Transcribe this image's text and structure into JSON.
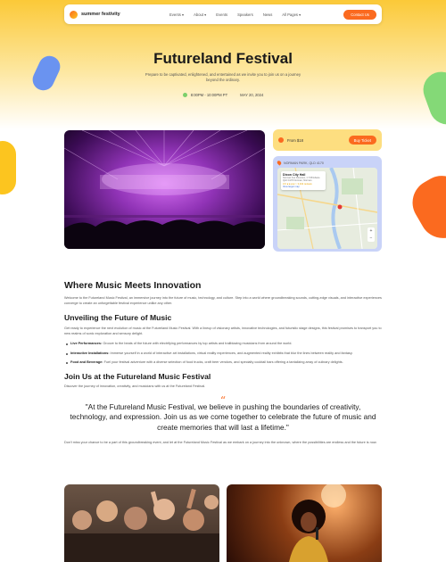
{
  "colors": {
    "accent": "#fb6a1f",
    "yellow": "#fcc51f",
    "price_card": "#fdde80",
    "map_card": "#c9d3f8",
    "text": "#1a1a1a"
  },
  "nav": {
    "brand": "summer festivity",
    "links": [
      "Events ▾",
      "About ▾",
      "Events",
      "Speakers",
      "News",
      "All Pages ▾"
    ],
    "cta": "Contact Us"
  },
  "hero": {
    "title": "Futureland Festival",
    "subtitle": "Prepare to be captivated, enlightened, and entertained as we invite you to join us on a journey beyond the ordinary.",
    "time": "8:00PM - 10:00PM PT",
    "date": "MAY 20, 2024"
  },
  "price": {
    "label": "From $18",
    "button": "Buy Ticket"
  },
  "map": {
    "address": "NORMAN PARK, QLD 4170",
    "place_name": "Dixon City Hall",
    "place_lines": [
      "Norman Ave Dixonton, C 5 Brisbane",
      "QLD 4170 Norman, Norman"
    ],
    "rating": "3.9 ★★★★☆ 3,432 reviews",
    "link": "View larger map"
  },
  "content": {
    "h_main": "Where Music Meets Innovation",
    "p_main": "Welcome to the Futureland Music Festival, an immersive journey into the future of music, technology, and culture. Step into a world where groundbreaking sounds, cutting-edge visuals, and interactive experiences converge to create an unforgettable festival experience unlike any other.",
    "h_unveil": "Unveiling the Future of Music",
    "p_unveil": "Get ready to experience the next evolution of music at the Futureland Music Festival. With a lineup of visionary artists, innovative technologies, and futuristic stage designs, this festival promises to transport you to new realms of sonic exploration and sensory delight.",
    "bullets": [
      {
        "bold": "Live Performances:",
        "text": "Groove to the beats of the future with electrifying performances by top artists and trailblazing musicians from around the world."
      },
      {
        "bold": "Interactive Installations:",
        "text": "Immerse yourself in a world of interactive art installations, virtual reality experiences, and augmented reality exhibits that blur the lines between reality and fantasy."
      },
      {
        "bold": "Food and Beverage:",
        "text": "Fuel your festival adventure with a diverse selection of food trucks, craft beer vendors, and specialty cocktail bars offering a tantalizing array of culinary delights."
      }
    ],
    "h_join": "Join Us at the Futureland Music Festival",
    "p_join": "Discover the journey of innovation, creativity, and musicians with us at the Futureland Festival.",
    "quote_mark": "“",
    "quote": "\"At the Futureland Music Festival, we believe in pushing the boundaries of creativity, technology, and expression. Join us as we come together to celebrate the future of music and create memories that will last a lifetime.\"",
    "p_closing": "Don't miss your chance to be a part of this groundbreaking event, and let at the Futureland Music Festival as we embark on a journey into the unknown, where the possibilities are endless and the future is now."
  }
}
